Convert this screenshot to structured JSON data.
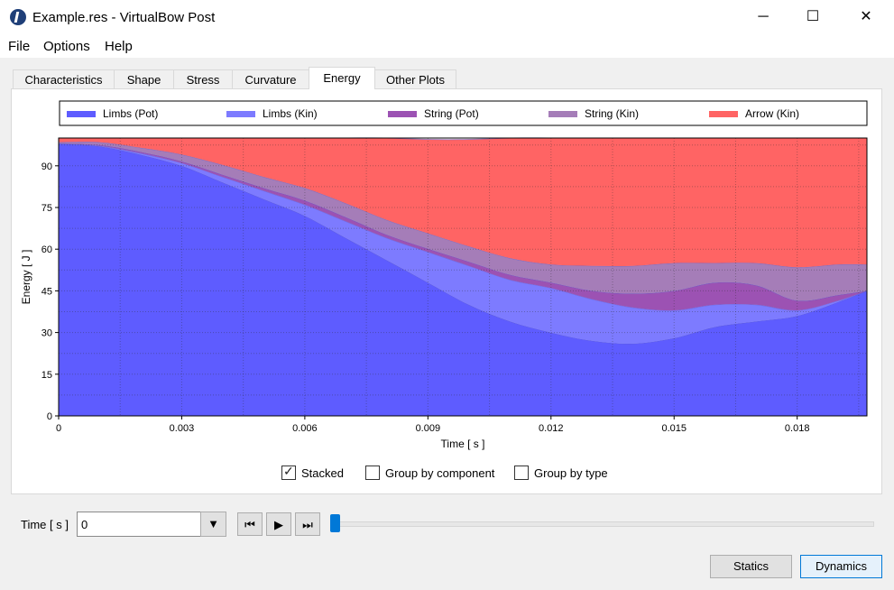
{
  "window": {
    "title": "Example.res - VirtualBow Post",
    "minimize_icon": "─",
    "maximize_icon": "☐",
    "close_icon": "✕"
  },
  "menu": [
    "File",
    "Options",
    "Help"
  ],
  "tabs": [
    "Characteristics",
    "Shape",
    "Stress",
    "Curvature",
    "Energy",
    "Other Plots"
  ],
  "active_tab": "Energy",
  "chart_data": {
    "type": "area",
    "stacked": true,
    "xlabel": "Time [ s ]",
    "ylabel": "Energy [ J ]",
    "xlim": [
      0,
      0.0197
    ],
    "ylim": [
      0,
      100
    ],
    "x_ticks": [
      "0",
      "0.003",
      "0.006",
      "0.009",
      "0.012",
      "0.015",
      "0.018"
    ],
    "x_tick_values": [
      0,
      0.003,
      0.006,
      0.009,
      0.012,
      0.015,
      0.018
    ],
    "y_ticks": [
      "0",
      "15",
      "30",
      "45",
      "60",
      "75",
      "90"
    ],
    "y_tick_values": [
      0,
      15,
      30,
      45,
      60,
      75,
      90
    ],
    "grid": true,
    "legend_position": "top",
    "x": [
      0,
      0.001,
      0.002,
      0.003,
      0.004,
      0.005,
      0.006,
      0.007,
      0.008,
      0.009,
      0.01,
      0.011,
      0.012,
      0.013,
      0.014,
      0.015,
      0.016,
      0.017,
      0.018,
      0.019,
      0.0197
    ],
    "series": [
      {
        "name": "Limbs (Pot)",
        "color": "#5e5cff",
        "values": [
          98,
          97,
          94,
          90,
          84,
          78,
          72,
          64,
          56,
          48,
          40,
          34,
          30,
          27,
          26,
          28,
          32,
          34,
          36,
          41,
          45
        ]
      },
      {
        "name": "Limbs (Kin)",
        "color": "#7d7bff",
        "values": [
          0,
          0.2,
          0.5,
          1,
          2,
          3,
          4,
          6,
          8,
          11,
          14,
          15,
          16,
          15,
          13,
          10,
          8,
          6,
          2,
          0.5,
          0
        ]
      },
      {
        "name": "String (Pot)",
        "color": "#9c52b3",
        "values": [
          0,
          0.3,
          0.5,
          0.6,
          0.8,
          1,
          1.5,
          1.5,
          1.2,
          1.2,
          1.5,
          1.8,
          2,
          3,
          5,
          7,
          8,
          7,
          3.5,
          2,
          0
        ]
      },
      {
        "name": "String (Kin)",
        "color": "#a57db8",
        "values": [
          0.5,
          1,
          1.5,
          2.5,
          3.5,
          4,
          4.5,
          5,
          5.3,
          5.5,
          5.5,
          6,
          6.5,
          9,
          10,
          10,
          7,
          8,
          12,
          11,
          9.5
        ]
      },
      {
        "name": "Arrow (Kin)",
        "color": "#ff6464",
        "values": [
          1.5,
          1.5,
          3.5,
          5.9,
          9.7,
          14,
          18,
          23.5,
          29.5,
          33.8,
          38.5,
          43.2,
          45.5,
          46,
          46,
          45,
          45,
          45,
          46.5,
          45.5,
          45.5
        ]
      }
    ]
  },
  "options": {
    "stacked": "Stacked",
    "group_component": "Group by component",
    "group_type": "Group by type"
  },
  "time_control": {
    "label": "Time [ s ]",
    "value": "0",
    "dropdown_icon": "▼",
    "first_icon": "⏮",
    "play_icon": "▶",
    "last_icon": "⏭",
    "slider_value": 0
  },
  "buttons": {
    "statics": "Statics",
    "dynamics": "Dynamics"
  }
}
